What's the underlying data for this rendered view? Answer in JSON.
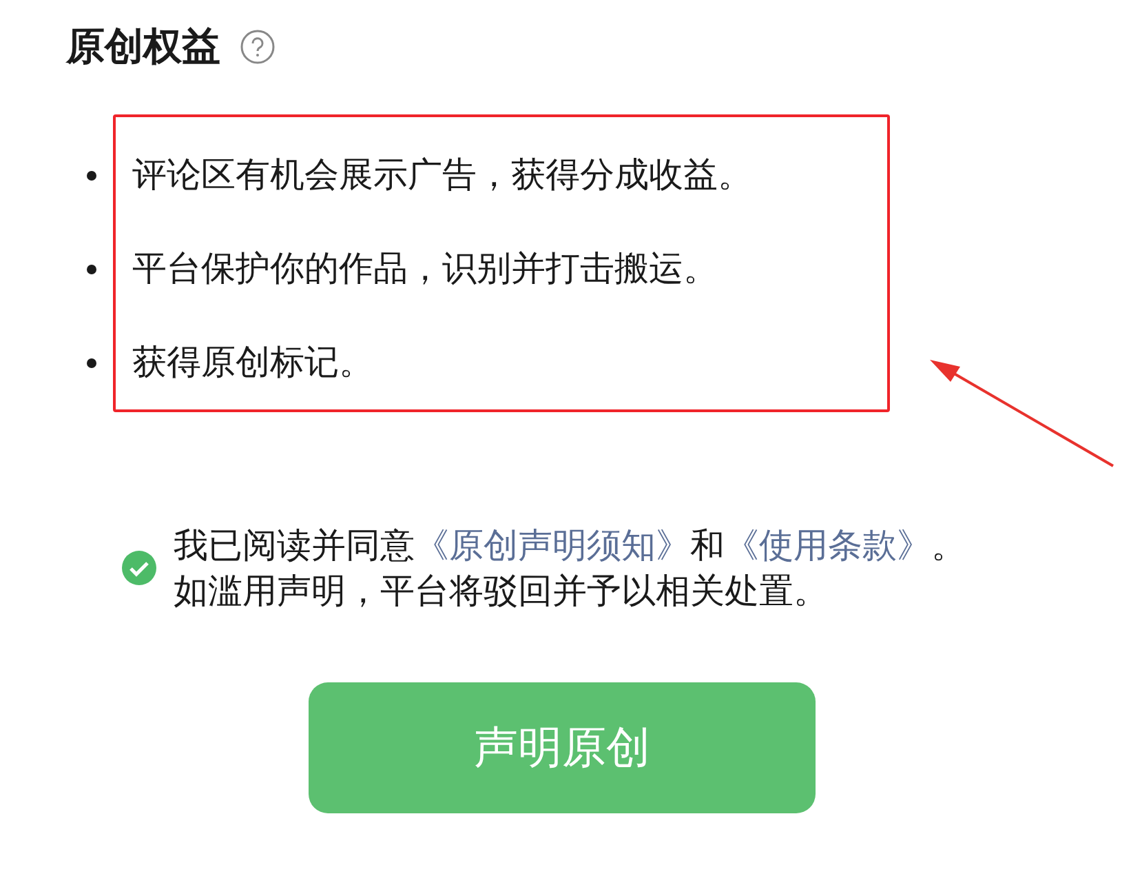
{
  "title": "原创权益",
  "benefits": [
    "评论区有机会展示广告，获得分成收益。",
    "平台保护你的作品，识别并打击搬运。",
    "获得原创标记。"
  ],
  "agreement": {
    "checked": true,
    "parts": [
      {
        "kind": "text",
        "text": "我已阅读并同意"
      },
      {
        "kind": "link",
        "text": "《原创声明须知》"
      },
      {
        "kind": "text",
        "text": "和"
      },
      {
        "kind": "link",
        "text": "《使用条款》"
      },
      {
        "kind": "text",
        "text": "。如滥用声明，平台将驳回并予以相关处置。"
      }
    ]
  },
  "button": "声明原创"
}
